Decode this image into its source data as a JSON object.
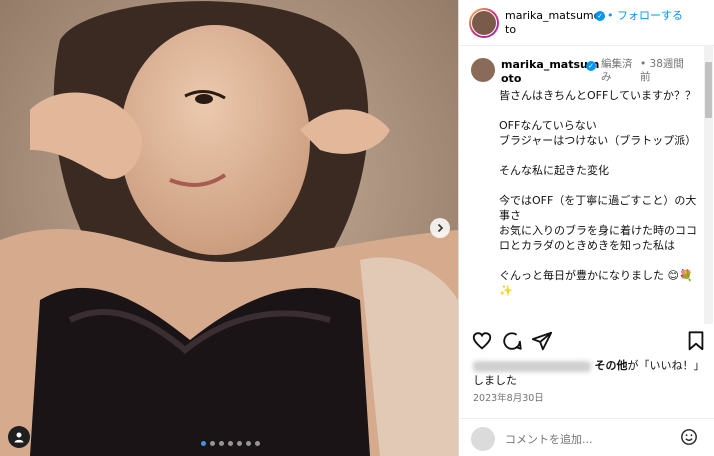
{
  "header": {
    "username": "marika_matsumoto",
    "username_line1": "marika_matsumo",
    "username_line2": "to",
    "follow_label": "• フォローする"
  },
  "caption": {
    "username_line1": "marika_matsum",
    "username_line2": "oto",
    "edited_label": "編集済",
    "edited_label_2": "み",
    "time_label": "• 38週間",
    "time_label_2": "前",
    "text": "皆さんはきちんとOFFしていますか？？\n\nOFFなんていらない\nブラジャーはつけない（ブラトップ派）\n\nそんな私に起きた変化\n\n今ではOFF（を丁寧に過ごすこと）の大事さ\nお気に入りのブラを身に着けた時のココロとカラダのときめきを知った私は\n\nぐんっと毎日が豊かになりました 😊💐✨"
  },
  "likes": {
    "others_label": "その他",
    "suffix": "が「いいね！」しました"
  },
  "date": "2023年8月30日",
  "comment": {
    "placeholder": "コメントを追加..."
  },
  "carousel": {
    "total_slides": 7,
    "active_slide": 1
  },
  "colors": {
    "accent": "#0095f6",
    "muted": "#737373"
  }
}
